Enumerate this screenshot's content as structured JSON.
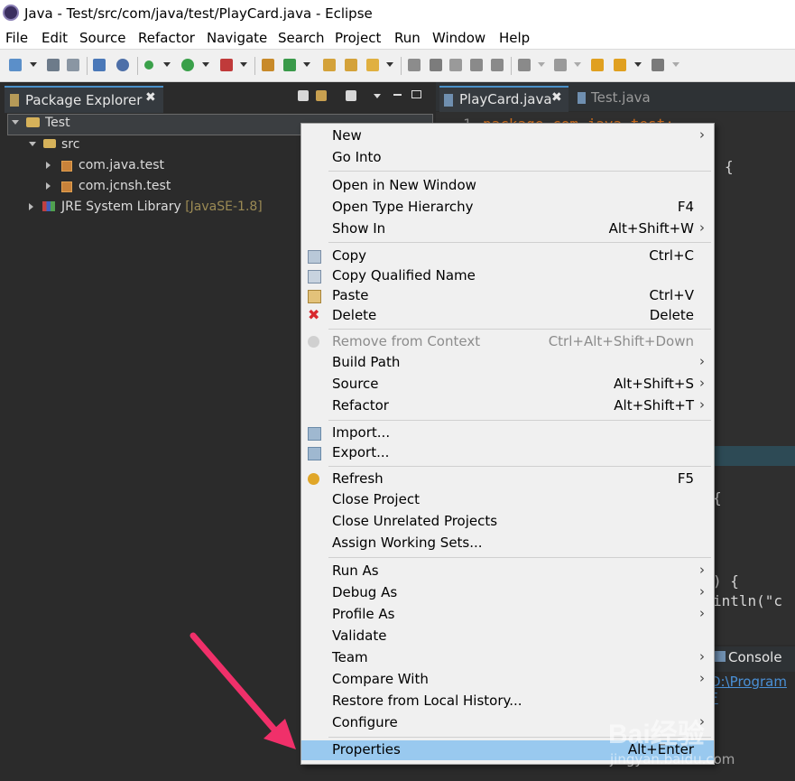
{
  "window": {
    "title": "Java - Test/src/com/java/test/PlayCard.java - Eclipse"
  },
  "menubar": [
    "File",
    "Edit",
    "Source",
    "Refactor",
    "Navigate",
    "Search",
    "Project",
    "Run",
    "Window",
    "Help"
  ],
  "package_explorer": {
    "tab_label": "Package Explorer",
    "close": "✖",
    "project": "Test",
    "src": "src",
    "packages": [
      "com.java.test",
      "com.jcnsh.test"
    ],
    "jre_label": "JRE System Library",
    "jre_version": "[JavaSE-1.8]"
  },
  "editor": {
    "tabs": [
      "PlayCard.java",
      "Test.java"
    ],
    "tab_close": "✖",
    "line_number": "1",
    "code_fragments": [
      "package com.java.test;",
      "{",
      "{",
      ") {",
      "intln(\"c"
    ]
  },
  "console": {
    "tab_label": "Console",
    "path_fragment": "D:\\Program F"
  },
  "context_menu": {
    "items": [
      {
        "label": "New",
        "shortcut": "",
        "submenu": true,
        "icon": ""
      },
      {
        "label": "Go Into",
        "shortcut": "",
        "submenu": false,
        "icon": ""
      },
      {
        "label": "Open in New Window",
        "shortcut": "",
        "submenu": false,
        "icon": ""
      },
      {
        "label": "Open Type Hierarchy",
        "shortcut": "F4",
        "submenu": false,
        "icon": ""
      },
      {
        "label": "Show In",
        "shortcut": "Alt+Shift+W",
        "submenu": true,
        "icon": ""
      },
      {
        "label": "Copy",
        "shortcut": "Ctrl+C",
        "submenu": false,
        "icon": "copy-icon"
      },
      {
        "label": "Copy Qualified Name",
        "shortcut": "",
        "submenu": false,
        "icon": "copy-qualified-icon"
      },
      {
        "label": "Paste",
        "shortcut": "Ctrl+V",
        "submenu": false,
        "icon": "paste-icon"
      },
      {
        "label": "Delete",
        "shortcut": "Delete",
        "submenu": false,
        "icon": "delete-icon"
      },
      {
        "label": "Remove from Context",
        "shortcut": "Ctrl+Alt+Shift+Down",
        "submenu": false,
        "icon": "remove-context-icon",
        "disabled": true
      },
      {
        "label": "Build Path",
        "shortcut": "",
        "submenu": true,
        "icon": ""
      },
      {
        "label": "Source",
        "shortcut": "Alt+Shift+S",
        "submenu": true,
        "icon": ""
      },
      {
        "label": "Refactor",
        "shortcut": "Alt+Shift+T",
        "submenu": true,
        "icon": ""
      },
      {
        "label": "Import...",
        "shortcut": "",
        "submenu": false,
        "icon": "import-icon"
      },
      {
        "label": "Export...",
        "shortcut": "",
        "submenu": false,
        "icon": "export-icon"
      },
      {
        "label": "Refresh",
        "shortcut": "F5",
        "submenu": false,
        "icon": "refresh-icon"
      },
      {
        "label": "Close Project",
        "shortcut": "",
        "submenu": false,
        "icon": ""
      },
      {
        "label": "Close Unrelated Projects",
        "shortcut": "",
        "submenu": false,
        "icon": ""
      },
      {
        "label": "Assign Working Sets...",
        "shortcut": "",
        "submenu": false,
        "icon": ""
      },
      {
        "label": "Run As",
        "shortcut": "",
        "submenu": true,
        "icon": ""
      },
      {
        "label": "Debug As",
        "shortcut": "",
        "submenu": true,
        "icon": ""
      },
      {
        "label": "Profile As",
        "shortcut": "",
        "submenu": true,
        "icon": ""
      },
      {
        "label": "Validate",
        "shortcut": "",
        "submenu": false,
        "icon": ""
      },
      {
        "label": "Team",
        "shortcut": "",
        "submenu": true,
        "icon": ""
      },
      {
        "label": "Compare With",
        "shortcut": "",
        "submenu": true,
        "icon": ""
      },
      {
        "label": "Restore from Local History...",
        "shortcut": "",
        "submenu": false,
        "icon": ""
      },
      {
        "label": "Configure",
        "shortcut": "",
        "submenu": true,
        "icon": ""
      },
      {
        "label": "Properties",
        "shortcut": "Alt+Enter",
        "submenu": false,
        "icon": "",
        "selected": true
      }
    ],
    "submenu_glyph": "›"
  },
  "watermark": {
    "brand": "Bai经验",
    "url": "jingyan.baidu.com"
  },
  "colors": {
    "selection": "#99c9ef",
    "annotation_arrow": "#f0306a",
    "jre_version": "#9b8a54"
  }
}
